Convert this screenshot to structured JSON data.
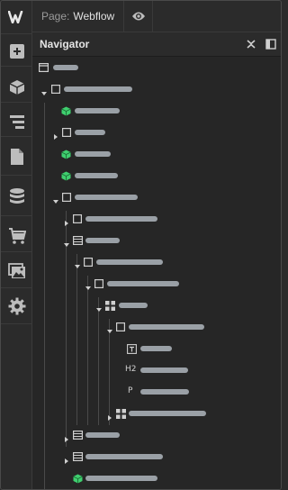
{
  "topbar": {
    "page_prefix": "Page:",
    "page_name": "Webflow"
  },
  "navigator": {
    "title": "Navigator"
  },
  "toolbar": {
    "items": [
      "logo-icon",
      "add-icon",
      "components-icon",
      "navigator-icon",
      "pages-icon",
      "cms-icon",
      "ecommerce-icon",
      "assets-icon",
      "settings-icon"
    ]
  },
  "tree": {
    "heading_tag": "H2",
    "paragraph_tag": "P"
  }
}
